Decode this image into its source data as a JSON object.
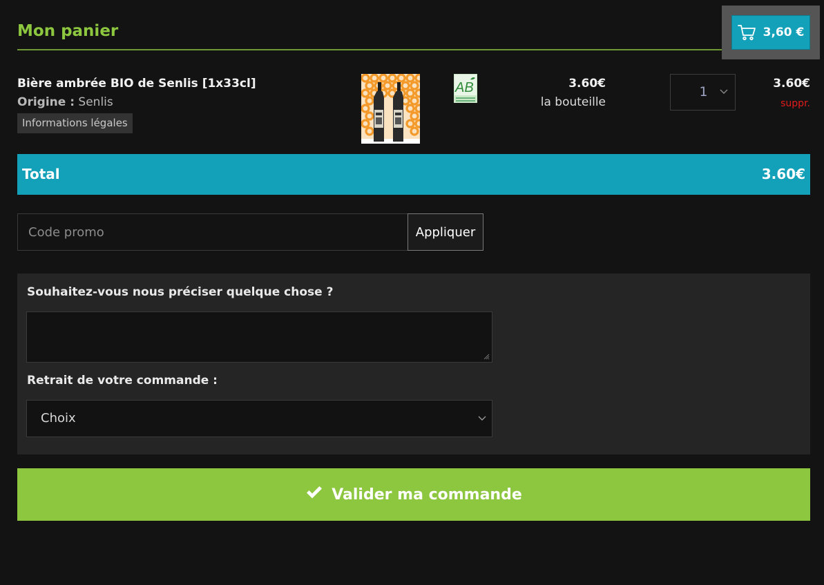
{
  "header": {
    "title": "Mon panier",
    "cart_total": "3,60 €",
    "cart_icon": "shopping-cart-icon"
  },
  "cart": {
    "items": [
      {
        "name": "Bière ambrée BIO de Senlis [1x33cl]",
        "origin_key": "Origine :",
        "origin_value": "Senlis",
        "legal_label": "Informations légales",
        "badge": "AB",
        "unit_price": "3.60€",
        "unit_label": "la bouteille",
        "quantity": "1",
        "line_total": "3.60€",
        "remove_label": "suppr."
      }
    ]
  },
  "total": {
    "label": "Total",
    "amount": "3.60€"
  },
  "promo": {
    "placeholder": "Code promo",
    "apply_label": "Appliquer"
  },
  "options": {
    "note_label": "Souhaitez-vous nous préciser quelque chose ?",
    "pickup_label": "Retrait de votre commande :",
    "pickup_selected": "Choix"
  },
  "actions": {
    "validate_label": "Valider ma commande",
    "validate_icon": "check-icon"
  },
  "colors": {
    "accent_green": "#8dc63f",
    "accent_blue": "#13a0b9",
    "remove_red": "#e41b1b",
    "background": "#131313"
  }
}
